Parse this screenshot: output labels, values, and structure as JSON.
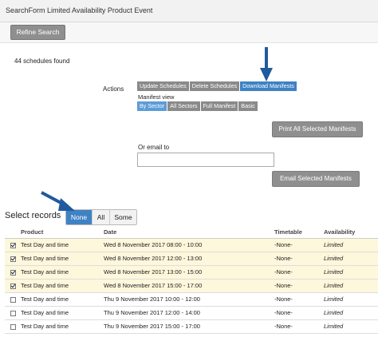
{
  "window": {
    "title": "SearchForm Limited Availability Product Event"
  },
  "toolbar": {
    "refine_label": "Refine Search"
  },
  "summary": {
    "found": "44 schedules found"
  },
  "actions": {
    "label": "Actions",
    "items": [
      "Update Schedules",
      "Delete Schedules",
      "Download Manifests"
    ],
    "active_index": 2
  },
  "manifest_view": {
    "label": "Manifest view",
    "items": [
      "By Sector",
      "All Sectors",
      "Full Manifest",
      "Basic"
    ],
    "active_index": 0
  },
  "print_button": "Print All Selected Manifests",
  "email": {
    "label": "Or email to",
    "value": "",
    "button": "Email Selected Manifests"
  },
  "select_records": {
    "label": "Select records",
    "options": [
      "None",
      "All",
      "Some"
    ],
    "selected": "None"
  },
  "table": {
    "headers": [
      "Product",
      "Date",
      "Timetable",
      "Availability"
    ],
    "rows": [
      {
        "checked": true,
        "product": "Test Day and time",
        "date": "Wed 8 November 2017 08:00 - 10:00",
        "timetable": "-None-",
        "availability": "Limited"
      },
      {
        "checked": true,
        "product": "Test Day and time",
        "date": "Wed 8 November 2017 12:00 - 13:00",
        "timetable": "-None-",
        "availability": "Limited"
      },
      {
        "checked": true,
        "product": "Test Day and time",
        "date": "Wed 8 November 2017 13:00 - 15:00",
        "timetable": "-None-",
        "availability": "Limited"
      },
      {
        "checked": true,
        "product": "Test Day and time",
        "date": "Wed 8 November 2017 15:00 - 17:00",
        "timetable": "-None-",
        "availability": "Limited"
      },
      {
        "checked": false,
        "product": "Test Day and time",
        "date": "Thu 9 November 2017 10:00 - 12:00",
        "timetable": "-None-",
        "availability": "Limited"
      },
      {
        "checked": false,
        "product": "Test Day and time",
        "date": "Thu 9 November 2017 12:00 - 14:00",
        "timetable": "-None-",
        "availability": "Limited"
      },
      {
        "checked": false,
        "product": "Test Day and time",
        "date": "Thu 9 November 2017 15:00 - 17:00",
        "timetable": "-None-",
        "availability": "Limited"
      }
    ]
  },
  "colors": {
    "accent": "#3f82c4",
    "selected_row": "#fdf7dc",
    "arrow": "#1f5a9e"
  }
}
